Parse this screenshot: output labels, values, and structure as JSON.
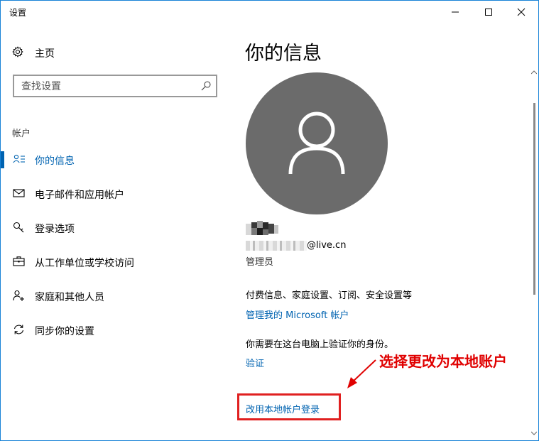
{
  "window": {
    "title": "设置"
  },
  "sidebar": {
    "home_label": "主页",
    "search_placeholder": "查找设置",
    "section_label": "帐户",
    "items": [
      {
        "label": "你的信息",
        "icon": "person-card-icon",
        "active": true
      },
      {
        "label": "电子邮件和应用帐户",
        "icon": "mail-icon",
        "active": false
      },
      {
        "label": "登录选项",
        "icon": "key-icon",
        "active": false
      },
      {
        "label": "从工作单位或学校访问",
        "icon": "briefcase-icon",
        "active": false
      },
      {
        "label": "家庭和其他人员",
        "icon": "person-add-icon",
        "active": false
      },
      {
        "label": "同步你的设置",
        "icon": "sync-icon",
        "active": false
      }
    ]
  },
  "main": {
    "heading": "你的信息",
    "email_domain": "@live.cn",
    "role": "管理员",
    "billing_text": "付费信息、家庭设置、订阅、安全设置等",
    "manage_link": "管理我的 Microsoft 帐户",
    "verify_prompt": "你需要在这台电脑上验证你的身份。",
    "verify_link": "验证",
    "local_account_link": "改用本地帐户登录"
  },
  "annotation": {
    "text": "选择更改为本地账户",
    "color": "#e00000"
  },
  "colors": {
    "accent": "#0063b1",
    "avatar_bg": "#6b6b6b",
    "highlight_border": "#e02020"
  }
}
